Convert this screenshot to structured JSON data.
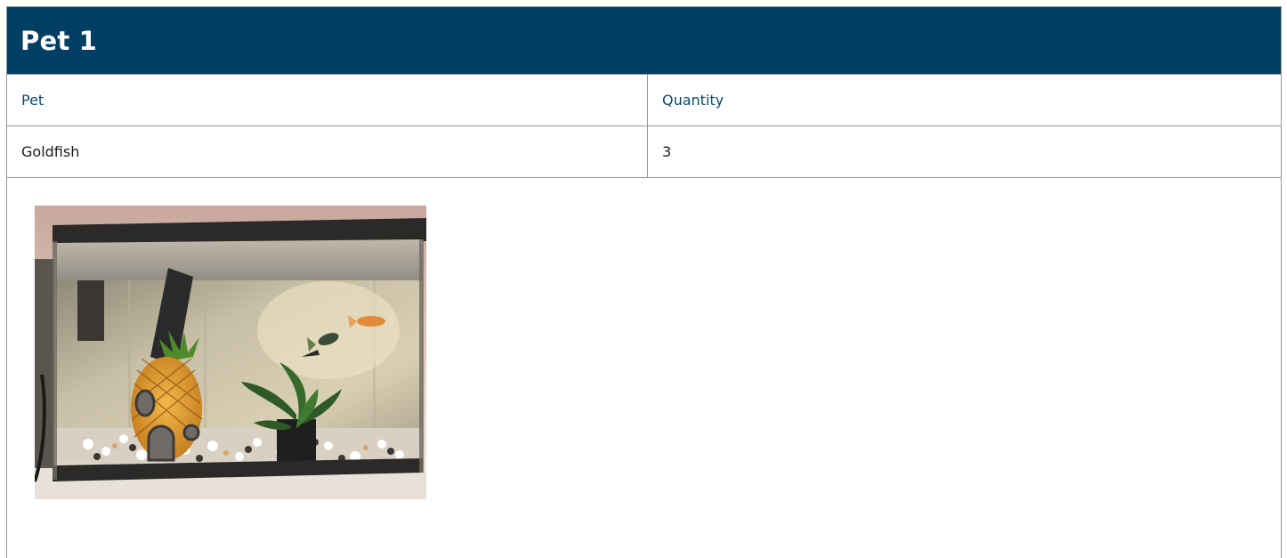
{
  "card": {
    "title": "Pet 1"
  },
  "table": {
    "headers": [
      "Pet",
      "Quantity"
    ],
    "rows": [
      [
        "Goldfish",
        "3"
      ]
    ]
  },
  "photo": {
    "alt": "Fish tank with pineapple house decoration, plant and gravel"
  },
  "colors": {
    "header_bg": "#003f63",
    "header_text": "#ffffff",
    "column_header_text": "#0b4a6b",
    "border": "#9a9a9a"
  }
}
